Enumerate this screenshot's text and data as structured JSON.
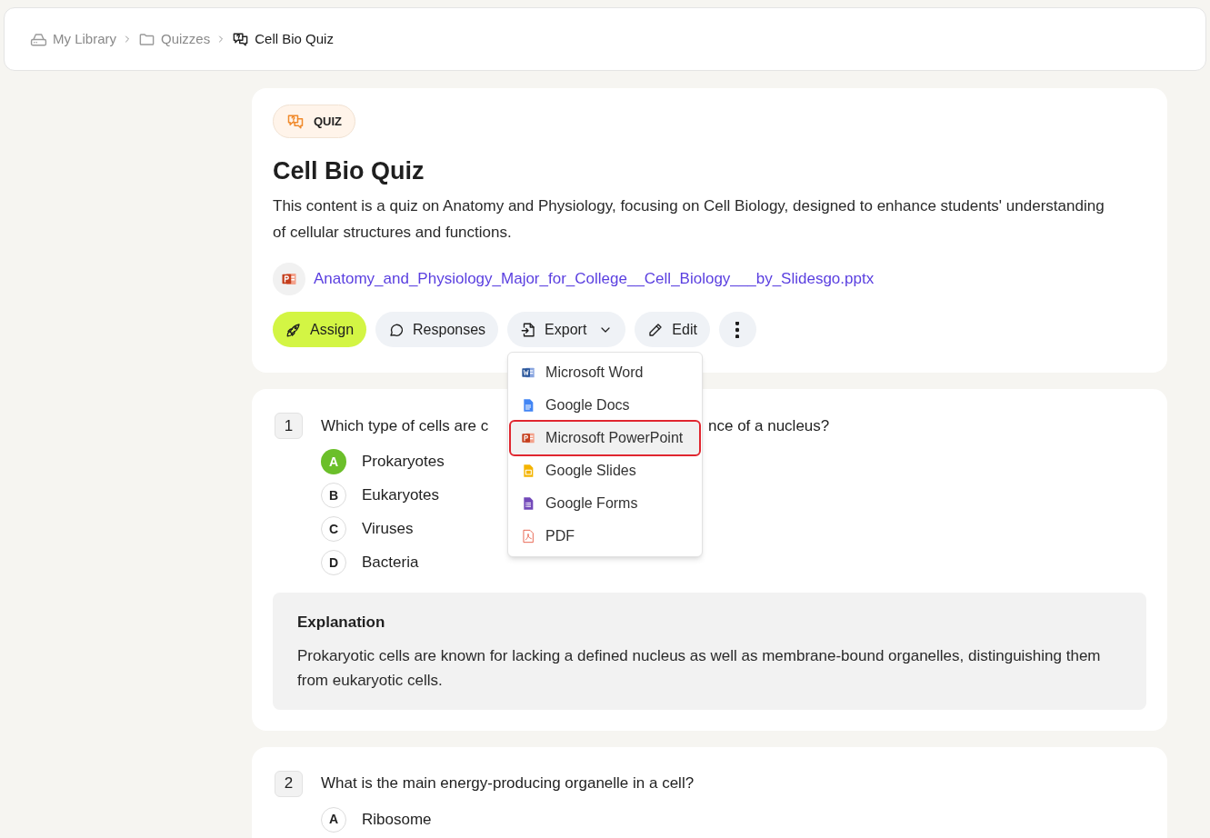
{
  "breadcrumb": [
    {
      "label": "My Library",
      "kind": "drive",
      "current": false
    },
    {
      "label": "Quizzes",
      "kind": "folder",
      "current": false
    },
    {
      "label": "Cell Bio Quiz",
      "kind": "quiz",
      "current": true
    }
  ],
  "header": {
    "badge": "QUIZ",
    "title": "Cell Bio Quiz",
    "description": "This content is a quiz on Anatomy and Physiology, focusing on Cell Biology, designed to enhance students' understanding of cellular structures and functions.",
    "attachment": {
      "kind": "powerpoint",
      "name": "Anatomy_and_Physiology_Major_for_College__Cell_Biology___by_Slidesgo.pptx"
    },
    "actions": [
      {
        "kind": "assign",
        "label": "Assign",
        "primary": true
      },
      {
        "kind": "responses",
        "label": "Responses",
        "primary": false
      },
      {
        "kind": "export",
        "label": "Export",
        "primary": false,
        "expanded": true
      },
      {
        "kind": "edit",
        "label": "Edit",
        "primary": false
      },
      {
        "kind": "more",
        "primary": false
      }
    ]
  },
  "export_menu": [
    {
      "kind": "word",
      "label": "Microsoft Word",
      "selected": false
    },
    {
      "kind": "docs",
      "label": "Google Docs",
      "selected": false
    },
    {
      "kind": "powerpoint",
      "label": "Microsoft PowerPoint",
      "selected": true
    },
    {
      "kind": "slides",
      "label": "Google Slides",
      "selected": false
    },
    {
      "kind": "forms",
      "label": "Google Forms",
      "selected": false
    },
    {
      "kind": "pdf",
      "label": "PDF",
      "selected": false
    }
  ],
  "questions": [
    {
      "number": "1",
      "text_parts": [
        "Which type of cells are c",
        "nce of a nucleus?"
      ],
      "options": [
        {
          "letter": "A",
          "text": "Prokaryotes",
          "correct": true
        },
        {
          "letter": "B",
          "text": "Eukaryotes",
          "correct": false
        },
        {
          "letter": "C",
          "text": "Viruses",
          "correct": false
        },
        {
          "letter": "D",
          "text": "Bacteria",
          "correct": false
        }
      ],
      "explanation": {
        "title": "Explanation",
        "text": "Prokaryotic cells are known for lacking a defined nucleus as well as membrane-bound organelles, distinguishing them from eukaryotic cells."
      }
    },
    {
      "number": "2",
      "text_parts": [
        "What is the main energy-producing organelle in a cell?"
      ],
      "options": [
        {
          "letter": "A",
          "text": "Ribosome",
          "correct": false
        }
      ]
    }
  ]
}
